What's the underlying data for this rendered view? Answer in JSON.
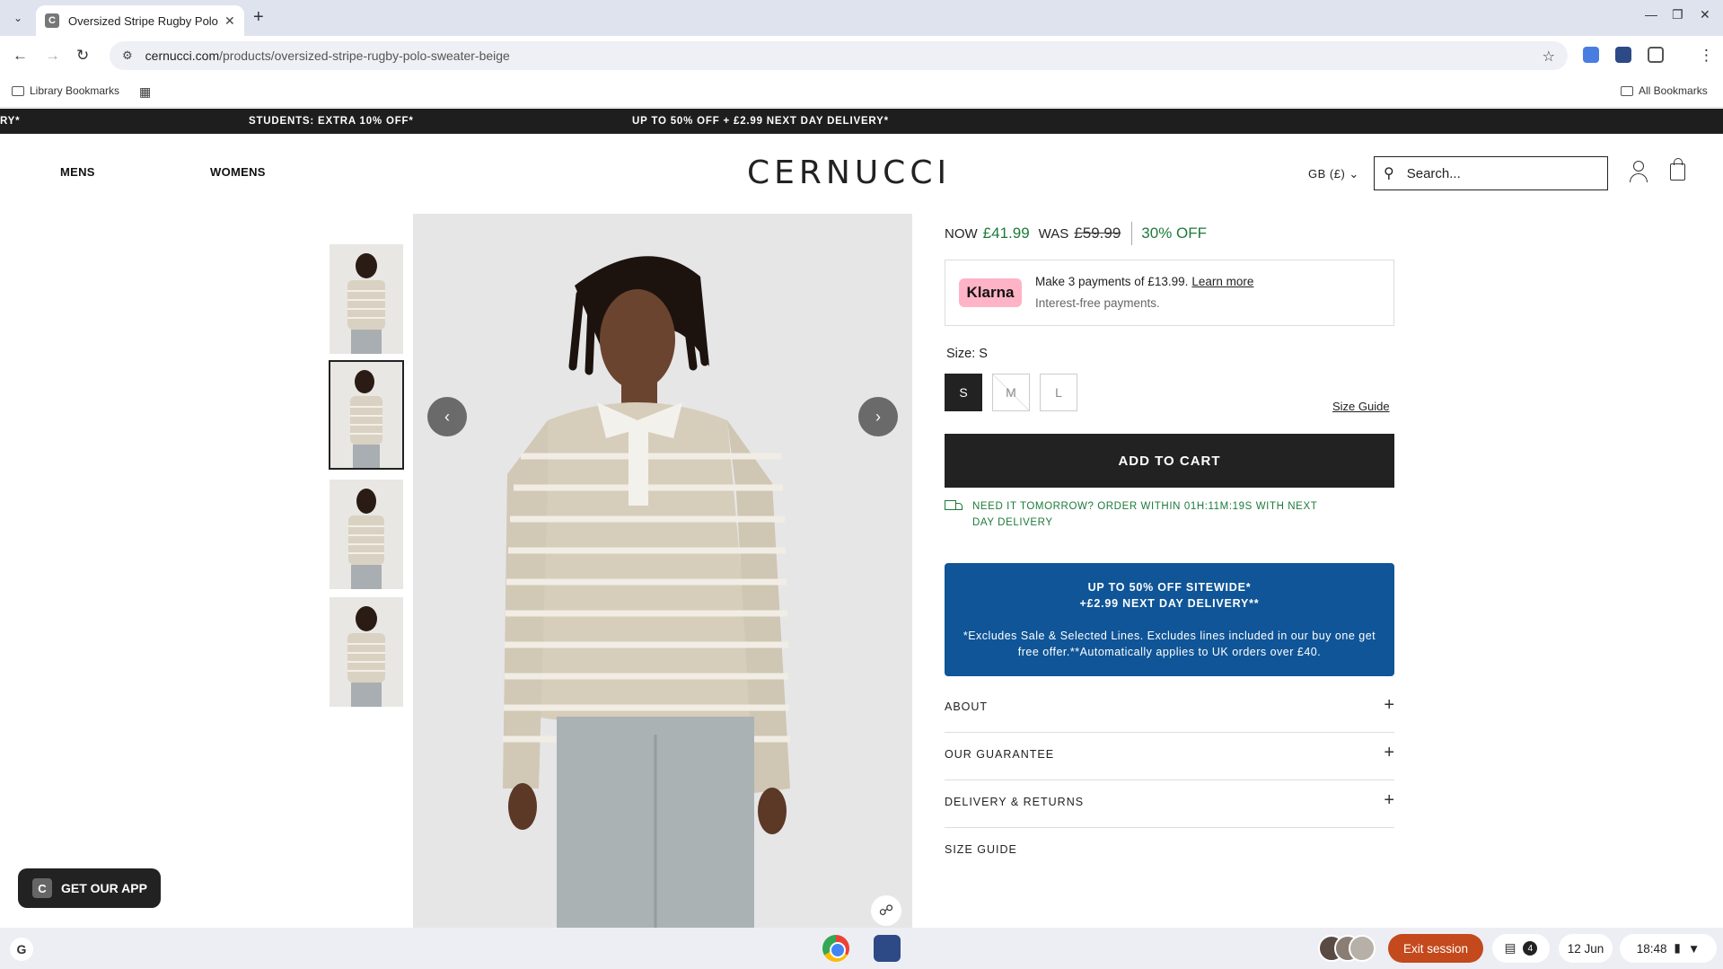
{
  "browser": {
    "tab_title": "Oversized Stripe Rugby Polo Sw",
    "tab_favicon": "C",
    "url_host": "cernucci.com",
    "url_path": "/products/oversized-stripe-rugby-polo-sweater-beige",
    "bookmark_library": "Library Bookmarks",
    "bookmark_all": "All Bookmarks"
  },
  "promo_bar": {
    "left_fragment": "RY*",
    "student": "STUDENTS: EXTRA 10% OFF*",
    "sale": "UP TO 50% OFF + £2.99 NEXT DAY DELIVERY*"
  },
  "header": {
    "nav_mens": "MENS",
    "nav_womens": "WOMENS",
    "logo": "CERNUCCI",
    "region": "GB (£)",
    "search_placeholder": "Search..."
  },
  "product": {
    "now_label": "NOW",
    "price_now": "£41.99",
    "was_label": "WAS",
    "price_was": "£59.99",
    "discount": "30% OFF",
    "klarna_brand": "Klarna",
    "klarna_line1": "Make 3 payments of £13.99.",
    "klarna_learn": "Learn more",
    "klarna_line2": "Interest-free payments.",
    "size_label": "Size: S",
    "sizes": [
      "S",
      "M",
      "L"
    ],
    "size_guide_link": "Size Guide",
    "add_to_cart": "ADD TO CART",
    "delivery_text": "NEED IT TOMORROW? ORDER WITHIN 01H:11M:19S WITH NEXT DAY DELIVERY",
    "promo_h1": "UP TO 50% OFF SITEWIDE*",
    "promo_h2": "+£2.99 NEXT DAY DELIVERY**",
    "promo_small": "*Excludes Sale & Selected Lines. Excludes lines included in our buy one get free offer.**Automatically applies to UK orders over £40.",
    "accordions": [
      "ABOUT",
      "OUR GUARANTEE",
      "DELIVERY & RETURNS",
      "SIZE GUIDE"
    ]
  },
  "app_pill": "GET OUR APP",
  "taskbar": {
    "launcher": "G",
    "exit": "Exit session",
    "notif_count": "4",
    "date": "12 Jun",
    "time": "18:48"
  },
  "colors": {
    "accent_green": "#1d7a3a",
    "promo_blue": "#0f5597",
    "dark": "#222222",
    "klarna_pink": "#ffb3c7",
    "exit_orange": "#c4491c"
  }
}
